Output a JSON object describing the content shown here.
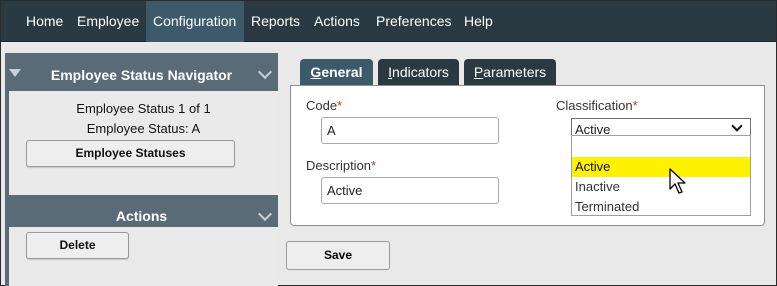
{
  "menu": {
    "items": [
      {
        "label": "Home"
      },
      {
        "label": "Employee"
      },
      {
        "label": "Configuration"
      },
      {
        "label": "Reports"
      },
      {
        "label": "Actions"
      },
      {
        "label": "Preferences"
      },
      {
        "label": "Help"
      }
    ],
    "active_index": 2
  },
  "navigator": {
    "title": "Employee Status Navigator",
    "status_count": "Employee Status 1 of 1",
    "status_current": "Employee Status: A",
    "button_label": "Employee Statuses",
    "collapse_icon": "chevron-down-icon",
    "expand_icon": "triangle-down-icon"
  },
  "actions_panel": {
    "title": "Actions",
    "delete_label": "Delete",
    "collapse_icon": "chevron-down-icon"
  },
  "tabs": [
    {
      "underlined": "G",
      "rest": "eneral"
    },
    {
      "underlined": "I",
      "rest": "ndicators"
    },
    {
      "underlined": "P",
      "rest": "arameters"
    }
  ],
  "active_tab": 0,
  "form": {
    "code_label": "Code",
    "code_value": "A",
    "description_label": "Description",
    "description_value": "Active",
    "classification_label": "Classification",
    "classification_value": "Active",
    "required_marker": "*",
    "classification_options": [
      "Active",
      "Inactive",
      "Terminated"
    ],
    "highlighted_option": 0
  },
  "save_label": "Save",
  "colors": {
    "menubar": "#2b3942",
    "menu_active": "#3d5a6b",
    "sidebar": "#5a6b78",
    "highlight": "#fff200",
    "required": "#c0392b"
  },
  "cursor_icon": "mouse-pointer-icon"
}
